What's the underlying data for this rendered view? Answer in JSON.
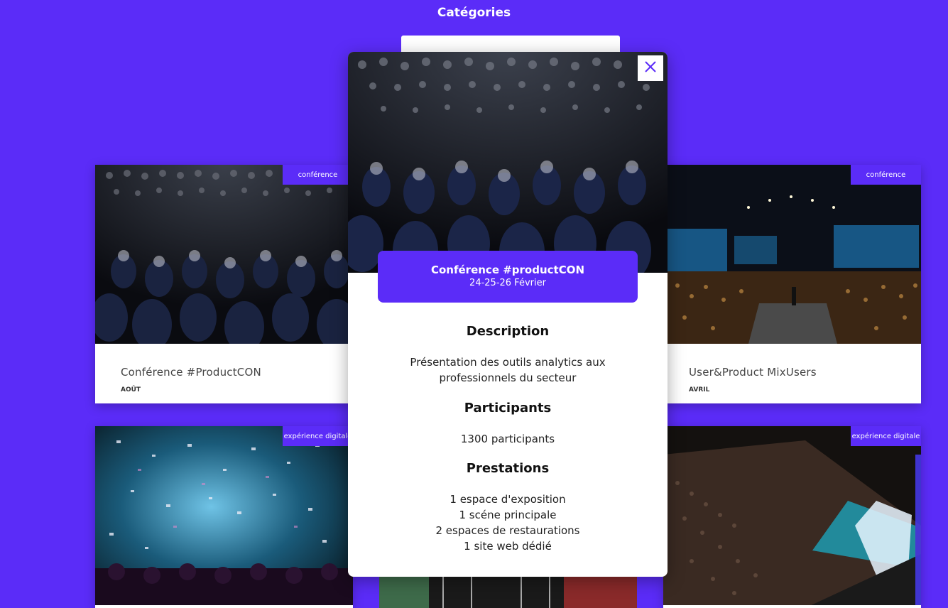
{
  "header": {
    "title": "Catégories"
  },
  "cards": [
    {
      "tag": "conférence",
      "name": "Conférence #ProductCON",
      "month": "AOÛT"
    },
    {
      "tag": "conférence",
      "name": "User&Product MixUsers",
      "month": "AVRIL"
    },
    {
      "tag": "expérience digitale"
    },
    {
      "tag": "expérience digitale"
    }
  ],
  "modal": {
    "title": "Conférence #productCON",
    "date": "24-25-26 Février",
    "description_heading": "Description",
    "description_text": "Présentation des outils analytics aux professionnels du secteur",
    "participants_heading": "Participants",
    "participants_text": "1300 participants",
    "prestations_heading": "Prestations",
    "prestations": [
      "1 espace d'exposition",
      "1 scéne principale",
      "2 espaces de restaurations",
      "1 site web dédié"
    ],
    "close_icon": "close-icon"
  },
  "colors": {
    "accent": "#5b2cf8",
    "text": "#222222"
  }
}
